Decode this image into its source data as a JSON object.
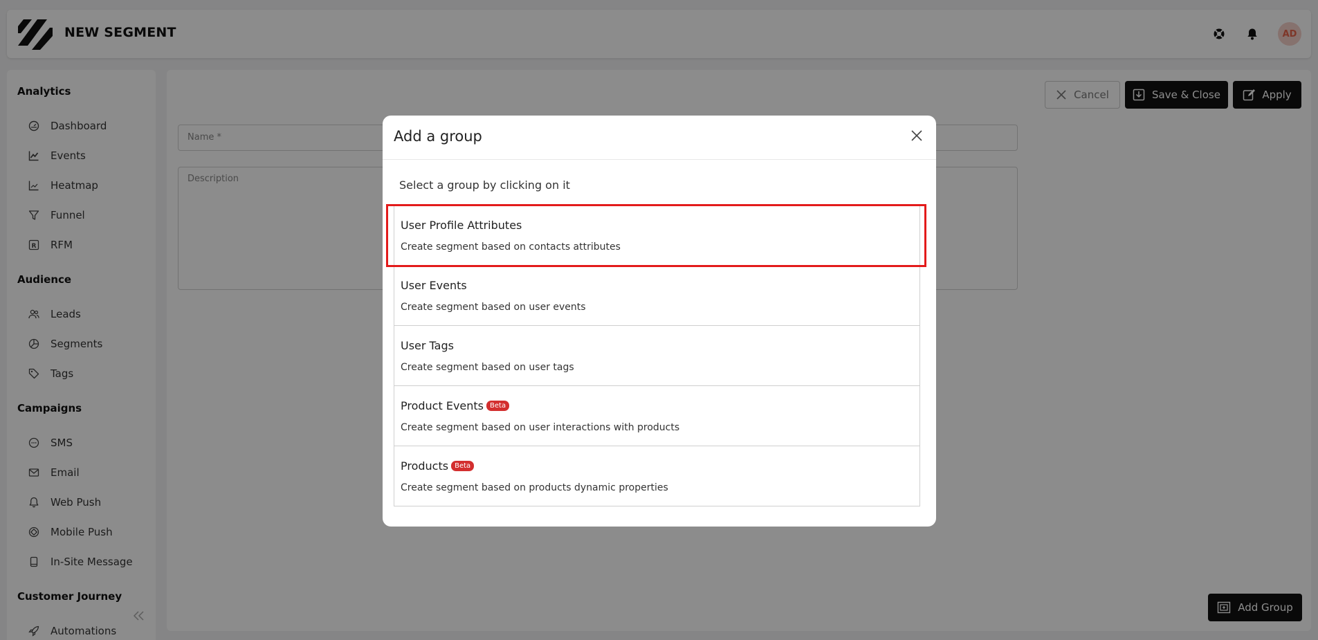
{
  "header": {
    "title": "NEW SEGMENT",
    "avatar_initials": "AD",
    "icons": [
      "support-icon",
      "bell-icon"
    ]
  },
  "sidebar": {
    "sections": [
      {
        "title": "Analytics",
        "items": [
          {
            "label": "Dashboard",
            "icon": "dashboard-icon"
          },
          {
            "label": "Events",
            "icon": "chart-line-icon"
          },
          {
            "label": "Heatmap",
            "icon": "chart-icon"
          },
          {
            "label": "Funnel",
            "icon": "funnel-icon"
          },
          {
            "label": "RFM",
            "icon": "rfm-icon"
          }
        ]
      },
      {
        "title": "Audience",
        "items": [
          {
            "label": "Leads",
            "icon": "users-icon"
          },
          {
            "label": "Segments",
            "icon": "pie-icon"
          },
          {
            "label": "Tags",
            "icon": "tag-icon"
          }
        ]
      },
      {
        "title": "Campaigns",
        "items": [
          {
            "label": "SMS",
            "icon": "sms-icon"
          },
          {
            "label": "Email",
            "icon": "mail-icon"
          },
          {
            "label": "Web Push",
            "icon": "bell-icon"
          },
          {
            "label": "Mobile Push",
            "icon": "mobile-push-icon"
          },
          {
            "label": "In-Site Message",
            "icon": "device-icon"
          }
        ]
      },
      {
        "title": "Customer Journey",
        "items": [
          {
            "label": "Automations",
            "icon": "rocket-icon"
          }
        ]
      }
    ]
  },
  "toolbar": {
    "cancel_label": "Cancel",
    "save_label": "Save & Close",
    "apply_label": "Apply"
  },
  "form": {
    "name_label": "Name *",
    "description_label": "Description"
  },
  "footer": {
    "add_group_label": "Add Group"
  },
  "modal": {
    "title": "Add a group",
    "subtitle": "Select a group by clicking on it",
    "groups": [
      {
        "title": "User Profile Attributes",
        "description": "Create segment based on contacts attributes",
        "badge": ""
      },
      {
        "title": "User Events",
        "description": "Create segment based on user events",
        "badge": ""
      },
      {
        "title": "User Tags",
        "description": "Create segment based on user tags",
        "badge": ""
      },
      {
        "title": "Product Events",
        "description": "Create segment based on user interactions with products",
        "badge": "Beta"
      },
      {
        "title": "Products",
        "description": "Create segment based on products dynamic properties",
        "badge": "Beta"
      }
    ],
    "highlighted_index": 0
  },
  "colors": {
    "highlight": "#e31b1b",
    "badge": "#d32f2f",
    "primary_button": "#111111",
    "avatar_bg": "#f4cfc8",
    "avatar_text": "#e5634a"
  }
}
